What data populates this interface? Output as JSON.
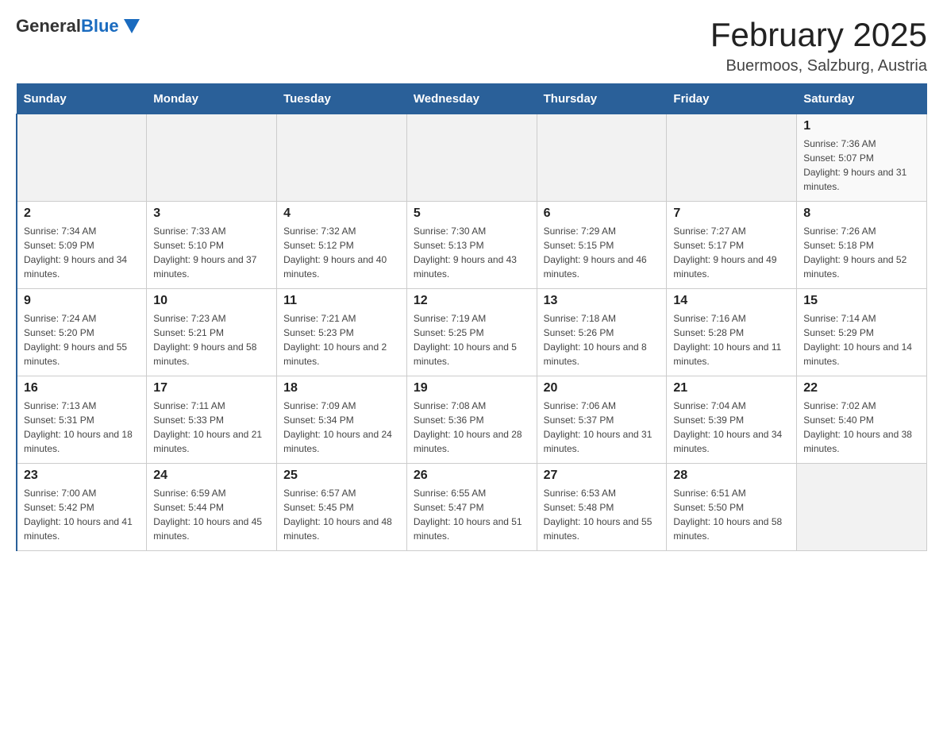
{
  "header": {
    "logo_general": "General",
    "logo_blue": "Blue",
    "month_title": "February 2025",
    "location": "Buermoos, Salzburg, Austria"
  },
  "weekdays": [
    "Sunday",
    "Monday",
    "Tuesday",
    "Wednesday",
    "Thursday",
    "Friday",
    "Saturday"
  ],
  "weeks": [
    [
      {
        "day": "",
        "info": ""
      },
      {
        "day": "",
        "info": ""
      },
      {
        "day": "",
        "info": ""
      },
      {
        "day": "",
        "info": ""
      },
      {
        "day": "",
        "info": ""
      },
      {
        "day": "",
        "info": ""
      },
      {
        "day": "1",
        "info": "Sunrise: 7:36 AM\nSunset: 5:07 PM\nDaylight: 9 hours and 31 minutes."
      }
    ],
    [
      {
        "day": "2",
        "info": "Sunrise: 7:34 AM\nSunset: 5:09 PM\nDaylight: 9 hours and 34 minutes."
      },
      {
        "day": "3",
        "info": "Sunrise: 7:33 AM\nSunset: 5:10 PM\nDaylight: 9 hours and 37 minutes."
      },
      {
        "day": "4",
        "info": "Sunrise: 7:32 AM\nSunset: 5:12 PM\nDaylight: 9 hours and 40 minutes."
      },
      {
        "day": "5",
        "info": "Sunrise: 7:30 AM\nSunset: 5:13 PM\nDaylight: 9 hours and 43 minutes."
      },
      {
        "day": "6",
        "info": "Sunrise: 7:29 AM\nSunset: 5:15 PM\nDaylight: 9 hours and 46 minutes."
      },
      {
        "day": "7",
        "info": "Sunrise: 7:27 AM\nSunset: 5:17 PM\nDaylight: 9 hours and 49 minutes."
      },
      {
        "day": "8",
        "info": "Sunrise: 7:26 AM\nSunset: 5:18 PM\nDaylight: 9 hours and 52 minutes."
      }
    ],
    [
      {
        "day": "9",
        "info": "Sunrise: 7:24 AM\nSunset: 5:20 PM\nDaylight: 9 hours and 55 minutes."
      },
      {
        "day": "10",
        "info": "Sunrise: 7:23 AM\nSunset: 5:21 PM\nDaylight: 9 hours and 58 minutes."
      },
      {
        "day": "11",
        "info": "Sunrise: 7:21 AM\nSunset: 5:23 PM\nDaylight: 10 hours and 2 minutes."
      },
      {
        "day": "12",
        "info": "Sunrise: 7:19 AM\nSunset: 5:25 PM\nDaylight: 10 hours and 5 minutes."
      },
      {
        "day": "13",
        "info": "Sunrise: 7:18 AM\nSunset: 5:26 PM\nDaylight: 10 hours and 8 minutes."
      },
      {
        "day": "14",
        "info": "Sunrise: 7:16 AM\nSunset: 5:28 PM\nDaylight: 10 hours and 11 minutes."
      },
      {
        "day": "15",
        "info": "Sunrise: 7:14 AM\nSunset: 5:29 PM\nDaylight: 10 hours and 14 minutes."
      }
    ],
    [
      {
        "day": "16",
        "info": "Sunrise: 7:13 AM\nSunset: 5:31 PM\nDaylight: 10 hours and 18 minutes."
      },
      {
        "day": "17",
        "info": "Sunrise: 7:11 AM\nSunset: 5:33 PM\nDaylight: 10 hours and 21 minutes."
      },
      {
        "day": "18",
        "info": "Sunrise: 7:09 AM\nSunset: 5:34 PM\nDaylight: 10 hours and 24 minutes."
      },
      {
        "day": "19",
        "info": "Sunrise: 7:08 AM\nSunset: 5:36 PM\nDaylight: 10 hours and 28 minutes."
      },
      {
        "day": "20",
        "info": "Sunrise: 7:06 AM\nSunset: 5:37 PM\nDaylight: 10 hours and 31 minutes."
      },
      {
        "day": "21",
        "info": "Sunrise: 7:04 AM\nSunset: 5:39 PM\nDaylight: 10 hours and 34 minutes."
      },
      {
        "day": "22",
        "info": "Sunrise: 7:02 AM\nSunset: 5:40 PM\nDaylight: 10 hours and 38 minutes."
      }
    ],
    [
      {
        "day": "23",
        "info": "Sunrise: 7:00 AM\nSunset: 5:42 PM\nDaylight: 10 hours and 41 minutes."
      },
      {
        "day": "24",
        "info": "Sunrise: 6:59 AM\nSunset: 5:44 PM\nDaylight: 10 hours and 45 minutes."
      },
      {
        "day": "25",
        "info": "Sunrise: 6:57 AM\nSunset: 5:45 PM\nDaylight: 10 hours and 48 minutes."
      },
      {
        "day": "26",
        "info": "Sunrise: 6:55 AM\nSunset: 5:47 PM\nDaylight: 10 hours and 51 minutes."
      },
      {
        "day": "27",
        "info": "Sunrise: 6:53 AM\nSunset: 5:48 PM\nDaylight: 10 hours and 55 minutes."
      },
      {
        "day": "28",
        "info": "Sunrise: 6:51 AM\nSunset: 5:50 PM\nDaylight: 10 hours and 58 minutes."
      },
      {
        "day": "",
        "info": ""
      }
    ]
  ]
}
